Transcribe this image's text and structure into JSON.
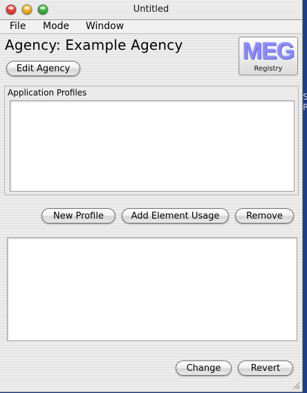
{
  "window": {
    "title": "Untitled"
  },
  "menu": {
    "items": [
      "File",
      "Mode",
      "Window"
    ]
  },
  "agency": {
    "heading": "Agency: Example Agency",
    "edit_button": "Edit Agency"
  },
  "logo": {
    "mark": "MEG",
    "caption": "Registry",
    "color": "#8c8cf0"
  },
  "profiles": {
    "group_label": "Application Profiles",
    "items": []
  },
  "actions": {
    "new_profile": "New Profile",
    "add_element_usage": "Add Element Usage",
    "remove": "Remove"
  },
  "detail": {
    "content": ""
  },
  "footer": {
    "change": "Change",
    "revert": "Revert"
  },
  "colors": {
    "close": "#e8443b",
    "minimize": "#f3b12e",
    "zoom": "#3fb343",
    "desktop": "#1f3c86"
  },
  "desktop_edge_text": [
    "S",
    "R"
  ]
}
